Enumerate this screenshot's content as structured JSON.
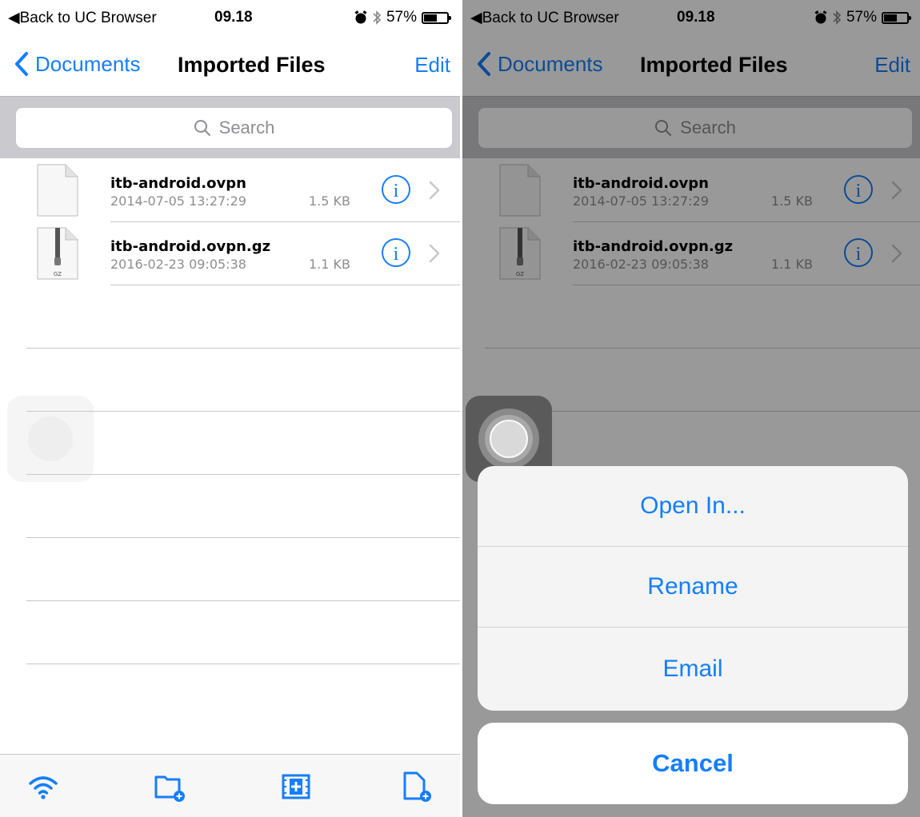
{
  "status_bar": {
    "back_label": "◀Back to UC Browser",
    "time": "09.18",
    "battery_percent": "57%",
    "battery_level": 0.57
  },
  "nav": {
    "back_label": "Documents",
    "title": "Imported Files",
    "edit_label": "Edit"
  },
  "search": {
    "placeholder": "Search"
  },
  "files": [
    {
      "name": "itb-android.ovpn",
      "date": "2014-07-05 13:27:29",
      "size": "1.5 KB",
      "icon": "document-icon"
    },
    {
      "name": "itb-android.ovpn.gz",
      "date": "2016-02-23 09:05:38",
      "size": "1.1 KB",
      "icon": "gz-archive-icon",
      "badge": "GZ"
    }
  ],
  "toolbar": {
    "icons": [
      "wifi-icon",
      "new-folder-icon",
      "add-media-icon",
      "new-file-icon"
    ]
  },
  "action_sheet": {
    "items": [
      "Open In...",
      "Rename",
      "Email"
    ],
    "cancel_label": "Cancel"
  },
  "colors": {
    "accent": "#157efb",
    "secondary_text": "#8e8e93",
    "separator": "#c8c7cc",
    "search_bar_bg": "#c9c9ce"
  }
}
